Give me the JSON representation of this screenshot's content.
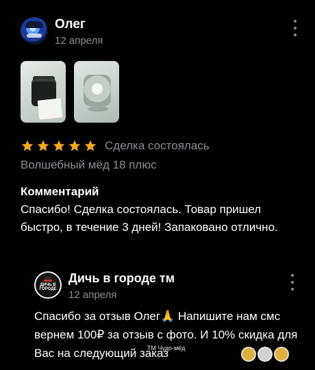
{
  "review": {
    "author": "Олег",
    "date": "12 апреля",
    "rating": 5,
    "deal_status": "Сделка состоялась",
    "product": "Волшебный мёд 18 плюс",
    "comment_heading": "Комментарий",
    "comment_text": "Спасибо! Сделка состоялась. Товар пришел быстро, в течение 3 дней! Запаковано отлично."
  },
  "reply": {
    "author": "Дичь в городе тм",
    "avatar_logo_text": "ДИЧЬ В ГОРОДЕ",
    "date": "12 апреля",
    "text": "Спасибо за отзыв Олег🙏 Напишите нам смс вернем 100₽ за отзыв с фото. И 10% скидка для Вас на следующий заказ",
    "watermark_label": "ТМ Чудо-мёд"
  },
  "colors": {
    "background": "#000000",
    "text_primary": "#ffffff",
    "text_secondary": "#8e8e93",
    "star": "#f5a623"
  },
  "icons": {
    "more": "more-vertical-icon",
    "star": "star-icon"
  }
}
